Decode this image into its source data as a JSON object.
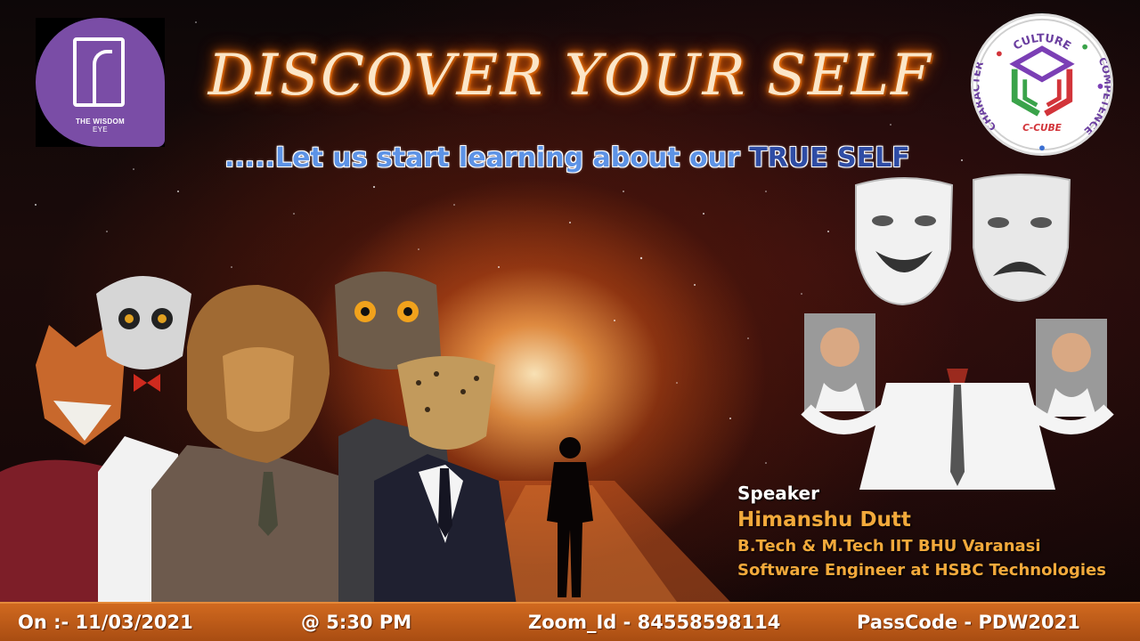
{
  "title": "DISCOVER YOUR SELF",
  "subtitle": {
    "lead": ".....Let us start learning about our ",
    "highlight": "TRUE SELF"
  },
  "logo_left": {
    "brand_bold": "THE WISDOM",
    "brand_rest": "EYE"
  },
  "logo_right": {
    "top": "CULTURE",
    "left": "CHARACTER",
    "right": "COMPETENCE",
    "center": "C-CUBE"
  },
  "speaker": {
    "label": "Speaker",
    "name": "Himanshu Dutt",
    "line1": "B.Tech & M.Tech IIT BHU Varanasi",
    "line2": "Software Engineer at HSBC Technologies"
  },
  "footer": {
    "date": "On :- 11/03/2021",
    "time": "@ 5:30 PM",
    "zoom": "Zoom_Id - 84558598114",
    "passcode": "PassCode - PDW2021"
  },
  "colors": {
    "footer_bar": "#c25f1b",
    "title_glow": "#ff6a00",
    "subtitle_blue": "#5d93e6",
    "speaker_orange": "#f2a93b",
    "logo_purple": "#7a4da6"
  }
}
